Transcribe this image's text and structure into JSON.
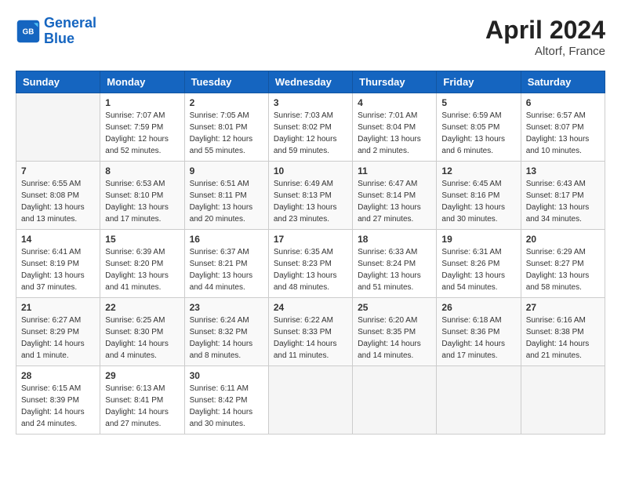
{
  "header": {
    "logo": {
      "line1": "General",
      "line2": "Blue"
    },
    "title": "April 2024",
    "location": "Altorf, France"
  },
  "weekdays": [
    "Sunday",
    "Monday",
    "Tuesday",
    "Wednesday",
    "Thursday",
    "Friday",
    "Saturday"
  ],
  "weeks": [
    [
      {
        "day": "",
        "sunrise": "",
        "sunset": "",
        "daylight": ""
      },
      {
        "day": "1",
        "sunrise": "Sunrise: 7:07 AM",
        "sunset": "Sunset: 7:59 PM",
        "daylight": "Daylight: 12 hours and 52 minutes."
      },
      {
        "day": "2",
        "sunrise": "Sunrise: 7:05 AM",
        "sunset": "Sunset: 8:01 PM",
        "daylight": "Daylight: 12 hours and 55 minutes."
      },
      {
        "day": "3",
        "sunrise": "Sunrise: 7:03 AM",
        "sunset": "Sunset: 8:02 PM",
        "daylight": "Daylight: 12 hours and 59 minutes."
      },
      {
        "day": "4",
        "sunrise": "Sunrise: 7:01 AM",
        "sunset": "Sunset: 8:04 PM",
        "daylight": "Daylight: 13 hours and 2 minutes."
      },
      {
        "day": "5",
        "sunrise": "Sunrise: 6:59 AM",
        "sunset": "Sunset: 8:05 PM",
        "daylight": "Daylight: 13 hours and 6 minutes."
      },
      {
        "day": "6",
        "sunrise": "Sunrise: 6:57 AM",
        "sunset": "Sunset: 8:07 PM",
        "daylight": "Daylight: 13 hours and 10 minutes."
      }
    ],
    [
      {
        "day": "7",
        "sunrise": "Sunrise: 6:55 AM",
        "sunset": "Sunset: 8:08 PM",
        "daylight": "Daylight: 13 hours and 13 minutes."
      },
      {
        "day": "8",
        "sunrise": "Sunrise: 6:53 AM",
        "sunset": "Sunset: 8:10 PM",
        "daylight": "Daylight: 13 hours and 17 minutes."
      },
      {
        "day": "9",
        "sunrise": "Sunrise: 6:51 AM",
        "sunset": "Sunset: 8:11 PM",
        "daylight": "Daylight: 13 hours and 20 minutes."
      },
      {
        "day": "10",
        "sunrise": "Sunrise: 6:49 AM",
        "sunset": "Sunset: 8:13 PM",
        "daylight": "Daylight: 13 hours and 23 minutes."
      },
      {
        "day": "11",
        "sunrise": "Sunrise: 6:47 AM",
        "sunset": "Sunset: 8:14 PM",
        "daylight": "Daylight: 13 hours and 27 minutes."
      },
      {
        "day": "12",
        "sunrise": "Sunrise: 6:45 AM",
        "sunset": "Sunset: 8:16 PM",
        "daylight": "Daylight: 13 hours and 30 minutes."
      },
      {
        "day": "13",
        "sunrise": "Sunrise: 6:43 AM",
        "sunset": "Sunset: 8:17 PM",
        "daylight": "Daylight: 13 hours and 34 minutes."
      }
    ],
    [
      {
        "day": "14",
        "sunrise": "Sunrise: 6:41 AM",
        "sunset": "Sunset: 8:19 PM",
        "daylight": "Daylight: 13 hours and 37 minutes."
      },
      {
        "day": "15",
        "sunrise": "Sunrise: 6:39 AM",
        "sunset": "Sunset: 8:20 PM",
        "daylight": "Daylight: 13 hours and 41 minutes."
      },
      {
        "day": "16",
        "sunrise": "Sunrise: 6:37 AM",
        "sunset": "Sunset: 8:21 PM",
        "daylight": "Daylight: 13 hours and 44 minutes."
      },
      {
        "day": "17",
        "sunrise": "Sunrise: 6:35 AM",
        "sunset": "Sunset: 8:23 PM",
        "daylight": "Daylight: 13 hours and 48 minutes."
      },
      {
        "day": "18",
        "sunrise": "Sunrise: 6:33 AM",
        "sunset": "Sunset: 8:24 PM",
        "daylight": "Daylight: 13 hours and 51 minutes."
      },
      {
        "day": "19",
        "sunrise": "Sunrise: 6:31 AM",
        "sunset": "Sunset: 8:26 PM",
        "daylight": "Daylight: 13 hours and 54 minutes."
      },
      {
        "day": "20",
        "sunrise": "Sunrise: 6:29 AM",
        "sunset": "Sunset: 8:27 PM",
        "daylight": "Daylight: 13 hours and 58 minutes."
      }
    ],
    [
      {
        "day": "21",
        "sunrise": "Sunrise: 6:27 AM",
        "sunset": "Sunset: 8:29 PM",
        "daylight": "Daylight: 14 hours and 1 minute."
      },
      {
        "day": "22",
        "sunrise": "Sunrise: 6:25 AM",
        "sunset": "Sunset: 8:30 PM",
        "daylight": "Daylight: 14 hours and 4 minutes."
      },
      {
        "day": "23",
        "sunrise": "Sunrise: 6:24 AM",
        "sunset": "Sunset: 8:32 PM",
        "daylight": "Daylight: 14 hours and 8 minutes."
      },
      {
        "day": "24",
        "sunrise": "Sunrise: 6:22 AM",
        "sunset": "Sunset: 8:33 PM",
        "daylight": "Daylight: 14 hours and 11 minutes."
      },
      {
        "day": "25",
        "sunrise": "Sunrise: 6:20 AM",
        "sunset": "Sunset: 8:35 PM",
        "daylight": "Daylight: 14 hours and 14 minutes."
      },
      {
        "day": "26",
        "sunrise": "Sunrise: 6:18 AM",
        "sunset": "Sunset: 8:36 PM",
        "daylight": "Daylight: 14 hours and 17 minutes."
      },
      {
        "day": "27",
        "sunrise": "Sunrise: 6:16 AM",
        "sunset": "Sunset: 8:38 PM",
        "daylight": "Daylight: 14 hours and 21 minutes."
      }
    ],
    [
      {
        "day": "28",
        "sunrise": "Sunrise: 6:15 AM",
        "sunset": "Sunset: 8:39 PM",
        "daylight": "Daylight: 14 hours and 24 minutes."
      },
      {
        "day": "29",
        "sunrise": "Sunrise: 6:13 AM",
        "sunset": "Sunset: 8:41 PM",
        "daylight": "Daylight: 14 hours and 27 minutes."
      },
      {
        "day": "30",
        "sunrise": "Sunrise: 6:11 AM",
        "sunset": "Sunset: 8:42 PM",
        "daylight": "Daylight: 14 hours and 30 minutes."
      },
      {
        "day": "",
        "sunrise": "",
        "sunset": "",
        "daylight": ""
      },
      {
        "day": "",
        "sunrise": "",
        "sunset": "",
        "daylight": ""
      },
      {
        "day": "",
        "sunrise": "",
        "sunset": "",
        "daylight": ""
      },
      {
        "day": "",
        "sunrise": "",
        "sunset": "",
        "daylight": ""
      }
    ]
  ]
}
